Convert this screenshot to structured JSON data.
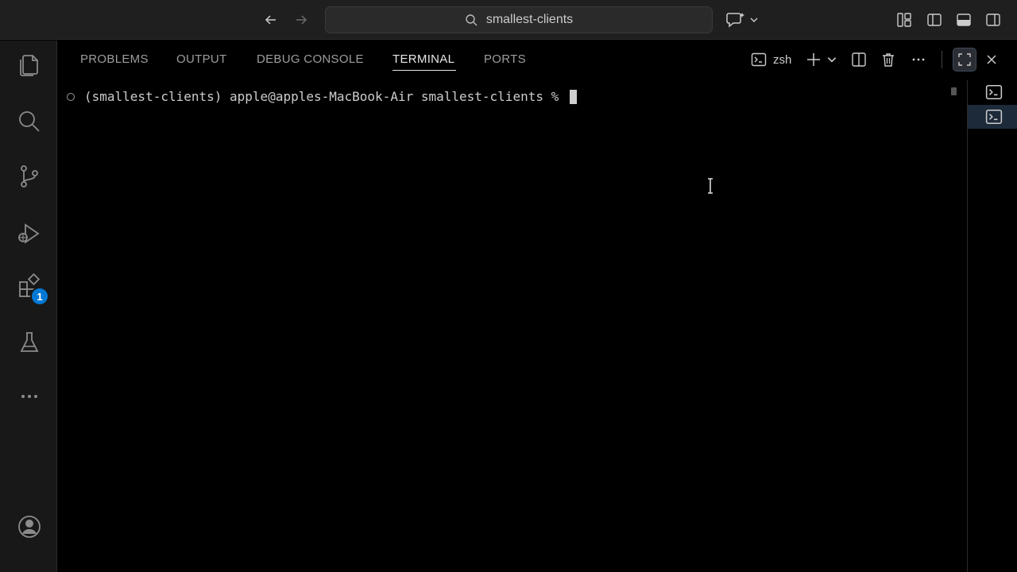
{
  "titlebar": {
    "search_text": "smallest-clients",
    "icons": [
      "arrow-left-icon",
      "arrow-right-icon",
      "search-icon",
      "copilot-icon",
      "chevron-down-icon",
      "customize-layout-icon",
      "toggle-primary-sidebar-icon",
      "toggle-panel-icon",
      "toggle-secondary-sidebar-icon"
    ]
  },
  "activitybar": {
    "items": [
      "explorer",
      "search",
      "source-control",
      "run-and-debug",
      "extensions",
      "testing",
      "more"
    ],
    "extensions_badge": "1",
    "bottom": [
      "accounts"
    ]
  },
  "panel": {
    "tabs": [
      {
        "label": "PROBLEMS",
        "active": false
      },
      {
        "label": "OUTPUT",
        "active": false
      },
      {
        "label": "DEBUG CONSOLE",
        "active": false
      },
      {
        "label": "TERMINAL",
        "active": true
      },
      {
        "label": "PORTS",
        "active": false
      }
    ],
    "shell_label": "zsh"
  },
  "terminal": {
    "prompt": "(smallest-clients) apple@apples-MacBook-Air smallest-clients % "
  },
  "terminal_list": {
    "entries": [
      "terminal-1",
      "terminal-2"
    ],
    "selected_index": 1
  },
  "colors": {
    "accent": "#0078d4",
    "background": "#000000",
    "chrome": "#1f1f1f",
    "activitybar": "#181818"
  }
}
